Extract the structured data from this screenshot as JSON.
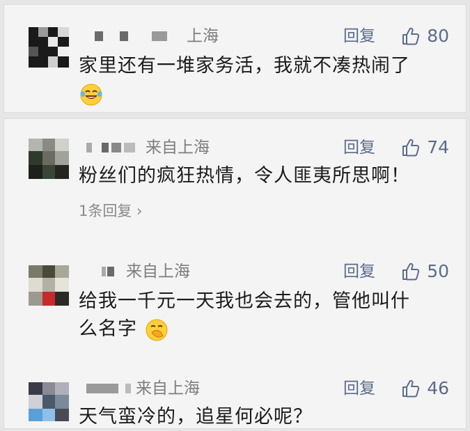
{
  "comments": [
    {
      "location": "上海",
      "reply_label": "回复",
      "likes": "80",
      "text": "家里还有一堆家务活，我就不凑热闹了",
      "emoji": "laughing-tears-icon"
    },
    {
      "location": "来自上海",
      "reply_label": "回复",
      "likes": "74",
      "text": "粉丝们的疯狂热情，令人匪夷所思啊！",
      "sub_replies": "1条回复"
    },
    {
      "location": "来自上海",
      "reply_label": "回复",
      "likes": "50",
      "text_line1": "给我一千元一天我也会去的，管他叫什",
      "text_line2": "么名字",
      "emoji": "hand-over-mouth-icon"
    },
    {
      "location": "来自上海",
      "reply_label": "回复",
      "likes": "46",
      "text": "天气蛮冷的，追星何必呢？"
    }
  ],
  "colors": {
    "link": "#5a6b8c",
    "location": "#7d7d7d",
    "background": "#e6e6e6",
    "card": "#f4f4f4"
  }
}
